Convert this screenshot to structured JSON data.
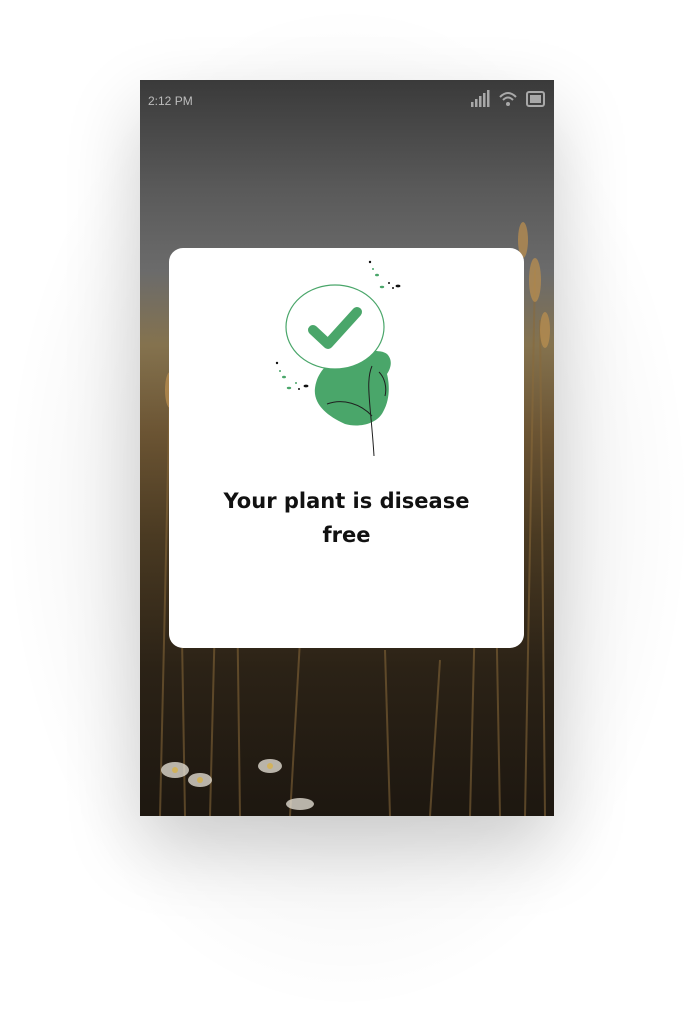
{
  "status_bar": {
    "time": "2:12 PM",
    "icons": [
      "signal-icon",
      "wifi-icon",
      "battery-icon"
    ]
  },
  "result_dialog": {
    "icon": "plant-check-icon",
    "message": "Your plant is disease free",
    "accent_color": "#4aa66a"
  }
}
